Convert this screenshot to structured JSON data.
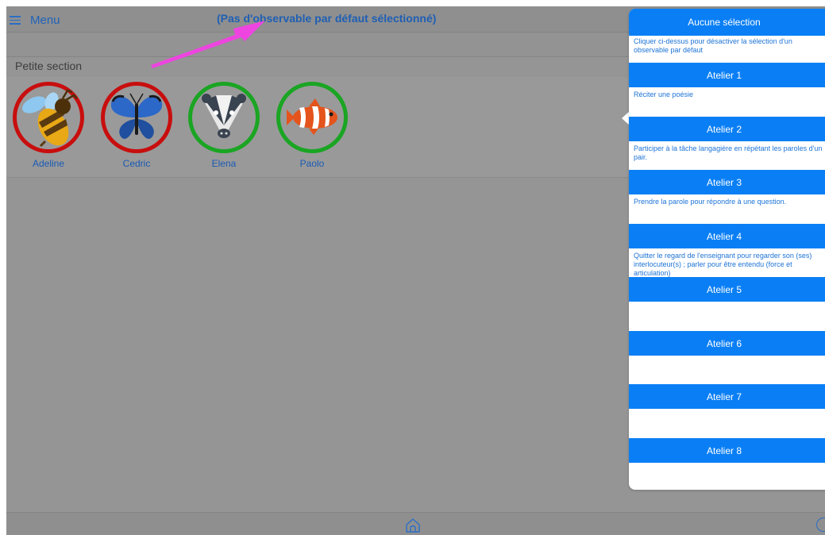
{
  "topbar": {
    "menu_label": "Menu",
    "title": "(Pas d'observable par défaut sélectionné)"
  },
  "section": {
    "label": "Petite section"
  },
  "students": [
    {
      "name": "Adeline",
      "animal": "bee",
      "ring_color": "#c80e0e"
    },
    {
      "name": "Cedric",
      "animal": "butterfly",
      "ring_color": "#c80e0e"
    },
    {
      "name": "Elena",
      "animal": "badger",
      "ring_color": "#1aa523"
    },
    {
      "name": "Paolo",
      "animal": "clownfish",
      "ring_color": "#1aa523"
    }
  ],
  "panel": {
    "none_label": "Aucune sélection",
    "none_desc": "Cliquer ci-dessus pour désactiver la sélection d'un observable par défaut",
    "ateliers": [
      {
        "label": "Atelier 1",
        "desc": "Réciter une poésie"
      },
      {
        "label": "Atelier 2",
        "desc": "Participer à la tâche langagière en répétant les paroles d'un pair."
      },
      {
        "label": "Atelier 3",
        "desc": "Prendre la parole pour répondre à une question."
      },
      {
        "label": "Atelier 4",
        "desc": "Quitter le regard de l'enseignant pour regarder son (ses) interlocuteur(s) ; parler pour être entendu (force et articulation)"
      },
      {
        "label": "Atelier 5",
        "desc": ""
      },
      {
        "label": "Atelier 6",
        "desc": ""
      },
      {
        "label": "Atelier 7",
        "desc": ""
      },
      {
        "label": "Atelier 8",
        "desc": ""
      }
    ]
  },
  "icons": {
    "menu": "hamburger-icon",
    "home": "home-icon",
    "help": "help-icon",
    "annotation": "magenta-arrow"
  },
  "colors": {
    "accent": "#0a7ff5",
    "link_text": "#1f62b9",
    "dim_background": "#959595",
    "annotation_arrow": "#ee44e0"
  }
}
